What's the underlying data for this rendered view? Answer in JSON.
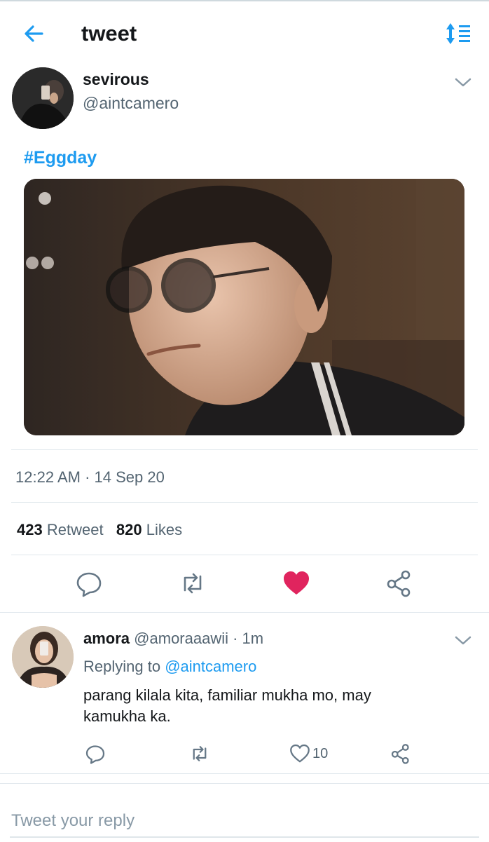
{
  "header": {
    "title": "tweet",
    "back_icon": "back-arrow-icon",
    "sort_icon": "sort-lines-icon"
  },
  "tweet": {
    "author_name": "sevirous",
    "author_handle": "@aintcamero",
    "text": "#Eggday",
    "timestamp": "12:22 AM · 14 Sep 20",
    "retweets": "423",
    "retweet_label": "Retweet",
    "likes": "820",
    "likes_label": "Likes",
    "liked": true
  },
  "reply": {
    "name": "amora",
    "handle": "@amoraaawii",
    "age": " · 1m",
    "replying_prefix": "Replying to ",
    "replying_to": "@aintcamero",
    "text": "parang kilala kita, familiar mukha mo, may kamukha ka.",
    "like_count": "10"
  },
  "composer": {
    "placeholder": "Tweet your reply"
  },
  "colors": {
    "accent": "#1d9bf0",
    "like": "#e0245e",
    "secondary_text": "#536471",
    "icon_gray": "#657786"
  }
}
